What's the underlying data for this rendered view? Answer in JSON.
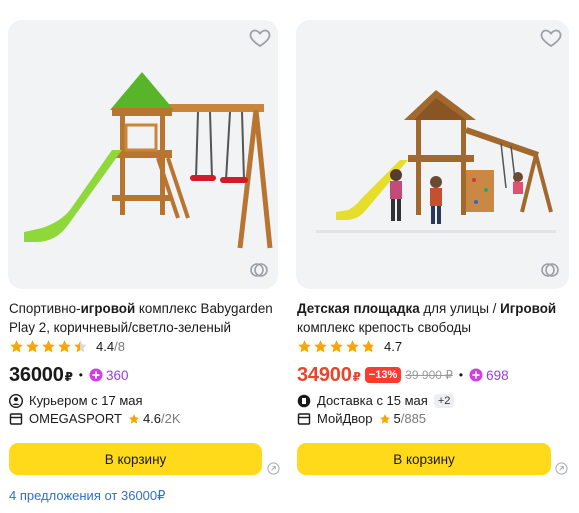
{
  "colors": {
    "accent": "#ffda1a",
    "sale_red": "#e8452c",
    "plus_purple": "#9c3ddb",
    "star": "#f7a600",
    "link": "#2e6fd8"
  },
  "products": [
    {
      "title_bold": "Спортивно-игровой комплекс Babygarden Play 2, коричневый/светло-зеленый",
      "title_part1": "Спортивно-",
      "title_part2": "игровой",
      "title_part3": " комплекс Babygarden Play 2, коричневый/светло-зеленый",
      "rating": "4.4",
      "reviews": "/8",
      "price": "36000",
      "currency": "₽",
      "plus_points": "360",
      "delivery": "Курьером с 17 мая",
      "shop_name": "OMEGASPORT",
      "shop_rating": "4.6",
      "shop_reviews": "/2K",
      "cart_label": "В корзину",
      "offers_link": "4 предложения от 36000₽"
    },
    {
      "title_part1": "Детская площадка",
      "title_part2": " для улицы / ",
      "title_part3": "Игровой",
      "title_part4": " комплекс крепость свободы",
      "rating": "4.7",
      "price": "34900",
      "currency": "₽",
      "discount": "−13%",
      "old_price": "39 900 ₽",
      "plus_points": "698",
      "delivery": "Доставка с 15 мая",
      "delivery_extra": "+2",
      "shop_name": "МойДвор",
      "shop_rating": "5",
      "shop_reviews": "/885",
      "cart_label": "В корзину"
    }
  ],
  "icons": [
    "heart-icon",
    "compare-icon",
    "star-icon",
    "plus-icon",
    "courier-icon",
    "delivery-icon",
    "store-icon",
    "external-link-icon"
  ]
}
